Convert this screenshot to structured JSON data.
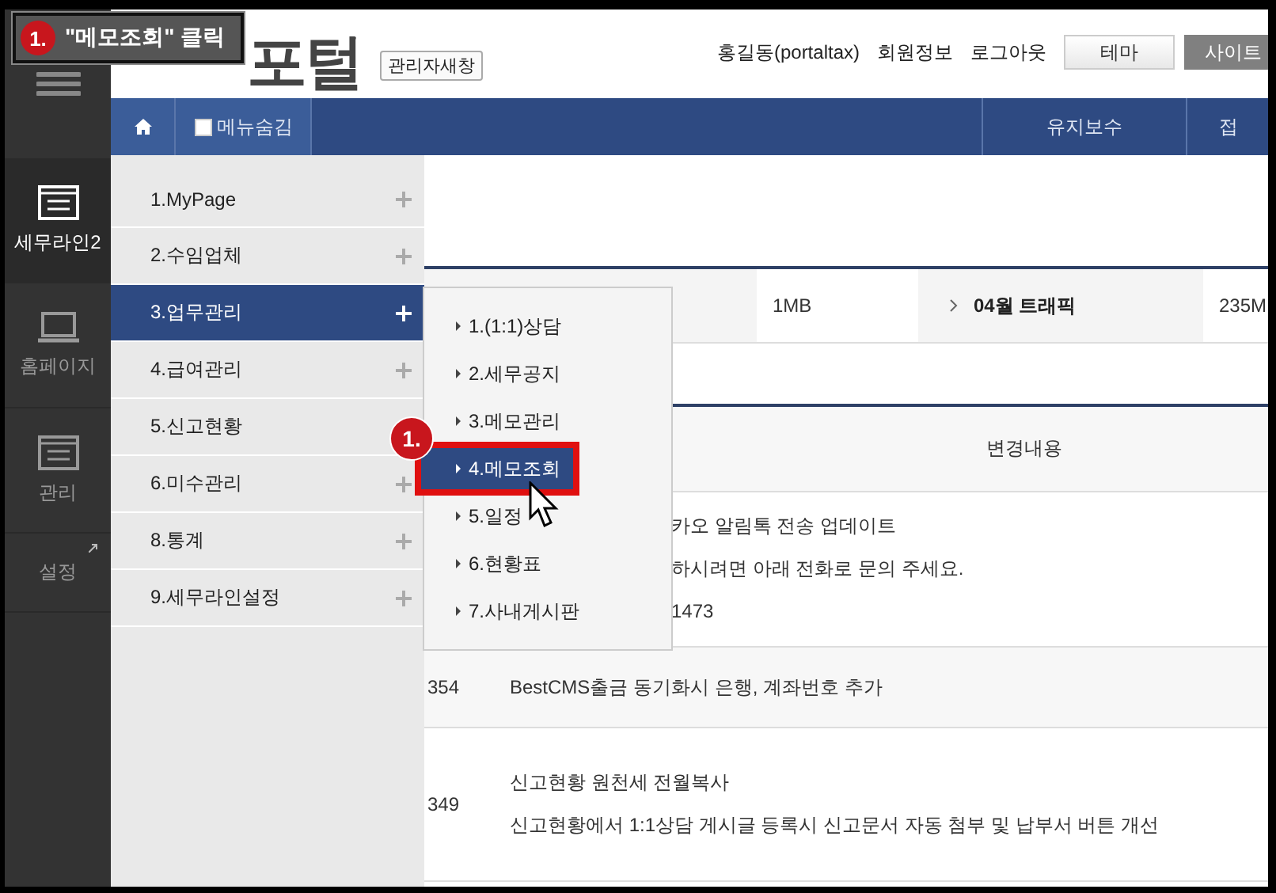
{
  "callout": {
    "number": "1.",
    "text": "\"메모조회\" 클릭"
  },
  "rail": {
    "items": [
      {
        "label": "세무라인2",
        "kind": "window",
        "selected": true
      },
      {
        "label": "홈페이지",
        "kind": "laptop",
        "selected": false
      },
      {
        "label": "관리",
        "kind": "window",
        "selected": false
      },
      {
        "label": "설정",
        "kind": "external",
        "selected": false
      }
    ]
  },
  "header": {
    "logo": "포털",
    "admin_button": "관리자새창",
    "user": "홍길동(portaltax)",
    "links": [
      "회원정보",
      "로그아웃"
    ],
    "buttons": [
      {
        "label": "테마",
        "kind": "light"
      },
      {
        "label": "사이트",
        "kind": "dark"
      }
    ]
  },
  "nav": {
    "hide_menu": {
      "label": "메뉴숨김",
      "checked": false
    },
    "tabs": [
      "유지보수",
      "접"
    ]
  },
  "menu": {
    "items": [
      {
        "label": "1.MyPage",
        "selected": false,
        "plus": true
      },
      {
        "label": "2.수임업체",
        "selected": false,
        "plus": true
      },
      {
        "label": "3.업무관리",
        "selected": true,
        "plus": true
      },
      {
        "label": "4.급여관리",
        "selected": false,
        "plus": true
      },
      {
        "label": "5.신고현황",
        "selected": false,
        "plus": false
      },
      {
        "label": "6.미수관리",
        "selected": false,
        "plus": true
      },
      {
        "label": "8.통계",
        "selected": false,
        "plus": true
      },
      {
        "label": "9.세무라인설정",
        "selected": false,
        "plus": true
      }
    ]
  },
  "submenu": {
    "badge": "1.",
    "items": [
      {
        "label": "1.(1:1)상담",
        "selected": false
      },
      {
        "label": "2.세무공지",
        "selected": false
      },
      {
        "label": "3.메모관리",
        "selected": false
      },
      {
        "label": "4.메모조회",
        "selected": true
      },
      {
        "label": "5.일정",
        "selected": false
      },
      {
        "label": "6.현황표",
        "selected": false
      },
      {
        "label": "7.사내게시판",
        "selected": false
      }
    ]
  },
  "stats": {
    "cells": [
      {
        "text": "1MB",
        "kind": "value"
      },
      {
        "text": "04월 트래픽",
        "kind": "label"
      },
      {
        "text": "235M",
        "kind": "value"
      }
    ]
  },
  "changes": {
    "header": "변경내용",
    "rows": [
      {
        "kind": "covered",
        "lines": [
          "카오 알림톡 전송 업데이트",
          "하시려면 아래 전화로 문의 주세요.",
          "1473"
        ]
      },
      {
        "kind": "full",
        "number": "354",
        "lines": [
          "BestCMS출금 동기화시 은행, 계좌번호 추가"
        ]
      },
      {
        "kind": "full",
        "number": "349",
        "lines": [
          "신고현황 원천세 전월복사",
          "신고현황에서 1:1상담 게시글 등록시 신고문서 자동 첨부 및 납부서 버튼 개선"
        ]
      }
    ]
  }
}
